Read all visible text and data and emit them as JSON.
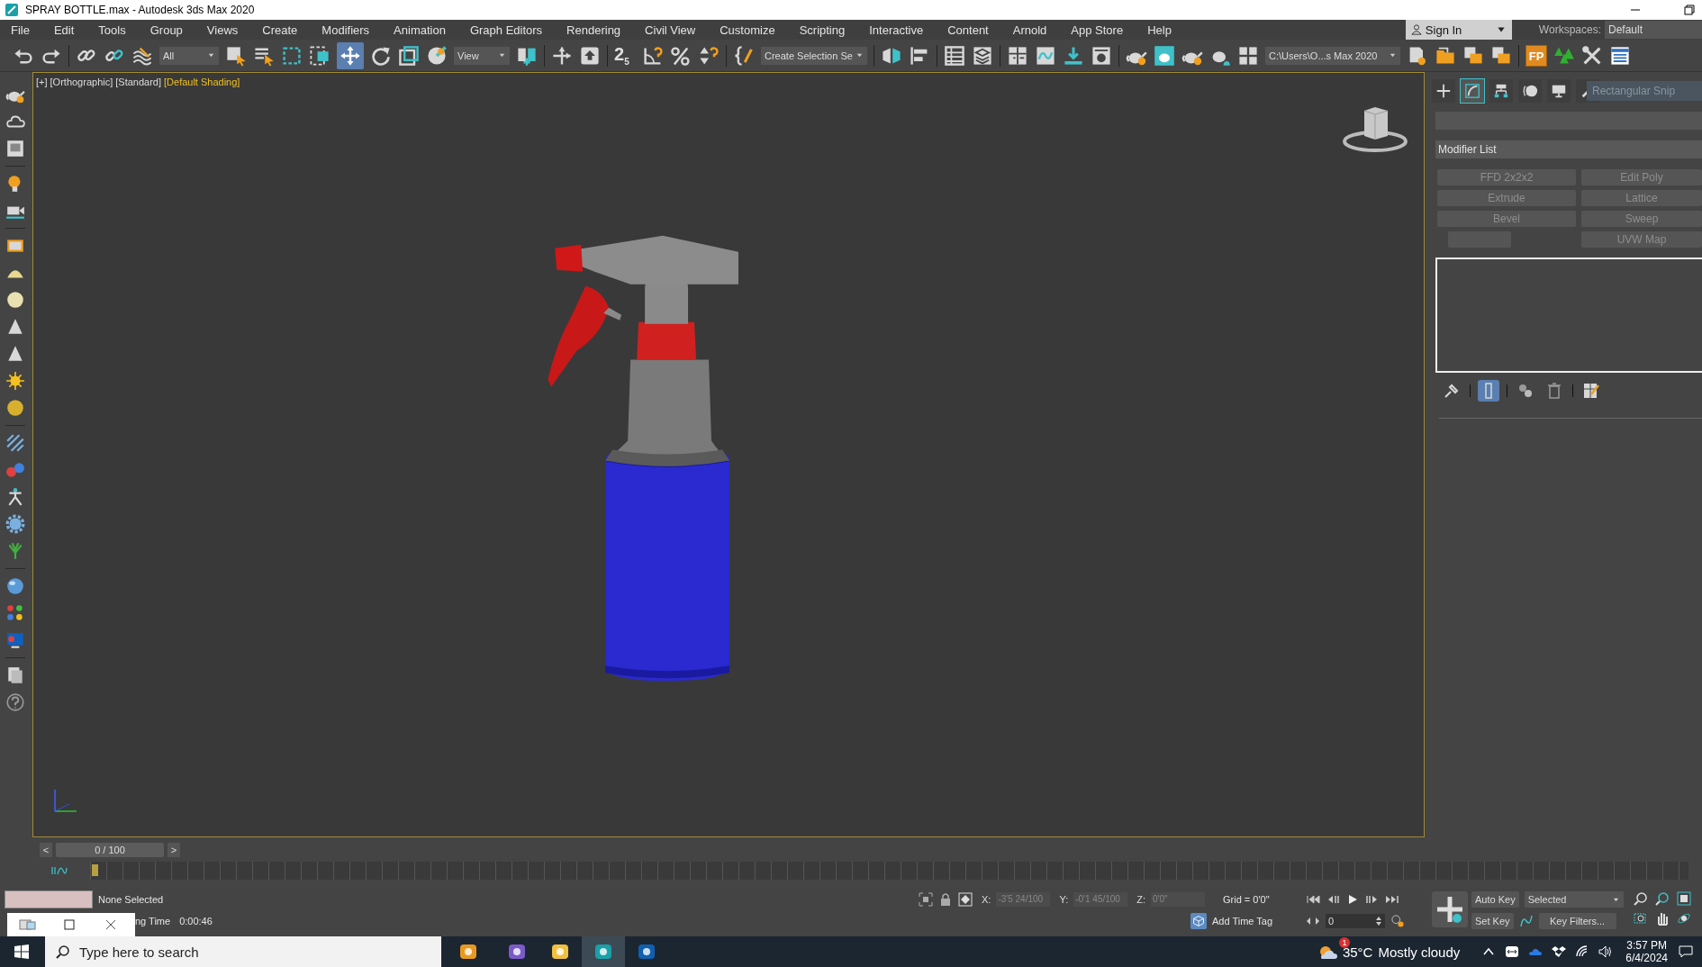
{
  "window": {
    "title": "SPRAY BOTTLE.max - Autodesk 3ds Max 2020"
  },
  "menu": [
    "File",
    "Edit",
    "Tools",
    "Group",
    "Views",
    "Create",
    "Modifiers",
    "Animation",
    "Graph Editors",
    "Rendering",
    "Civil View",
    "Customize",
    "Scripting",
    "Interactive",
    "Content",
    "Arnold",
    "App Store",
    "Help"
  ],
  "account": {
    "sign_in": "Sign In",
    "workspaces_label": "Workspaces:",
    "workspace": "Default"
  },
  "toolbar": {
    "selection_filter": "All",
    "reference_coordinates": "View",
    "snaps_toggle": "2$_{5}$",
    "named_selection": "Create Selection Se",
    "project_folder": "C:\\Users\\O...s Max 2020",
    "fp_button": "FP"
  },
  "viewport": {
    "labels": [
      {
        "text": "[+]",
        "highlighted": false
      },
      {
        "text": "[Orthographic]",
        "highlighted": false
      },
      {
        "text": "[Standard]",
        "highlighted": false
      },
      {
        "text": "[Default Shading]",
        "highlighted": true
      }
    ]
  },
  "command_panel": {
    "tabs": [
      {
        "kind": "create",
        "selected": false
      },
      {
        "kind": "modify",
        "selected": true
      },
      {
        "kind": "hierarchy",
        "selected": false
      },
      {
        "kind": "motion",
        "selected": false
      },
      {
        "kind": "display",
        "selected": false
      },
      {
        "kind": "utilities",
        "selected": false
      }
    ],
    "snip_tooltip": "Rectangular Snip",
    "modifier_list": "Modifier List",
    "modifier_buttons_left": [
      "FFD 2x2x2",
      "Extrude",
      "Bevel"
    ],
    "modifier_buttons_right": [
      "Edit Poly",
      "Lattice",
      "Sweep",
      "UVW Map"
    ],
    "stack_tools": [
      {
        "kind": "pin",
        "selected": false
      },
      {
        "kind": "end-result",
        "selected": true
      },
      {
        "kind": "make-unique",
        "selected": false
      },
      {
        "kind": "remove",
        "selected": false
      },
      {
        "kind": "configure",
        "selected": false
      }
    ]
  },
  "time_slider": {
    "prev": "<",
    "position": "0 / 100",
    "level": 0,
    "next": ">"
  },
  "status": {
    "selection": "None Selected",
    "running_time_label": "ng Time",
    "running_time": "0:00:46",
    "x_label": "X:",
    "x": "-3'5 24/100",
    "y_label": "Y:",
    "y": "-0'1 45/100",
    "z_label": "Z:",
    "z": "0'0\"",
    "grid": "Grid = 0'0\"",
    "add_time_tag": "Add Time Tag",
    "frame": "0",
    "auto_key": "Auto Key",
    "key_mode": "Selected",
    "set_key": "Set Key",
    "key_filters": "Key Filters..."
  },
  "taskbar": {
    "search_placeholder": "Type here to search",
    "apps": [
      {
        "kind": "briefcase",
        "selected": false
      },
      {
        "kind": "torrent",
        "selected": false
      },
      {
        "kind": "folder",
        "selected": false
      },
      {
        "kind": "max",
        "selected": true
      },
      {
        "kind": "sketch",
        "selected": false
      }
    ],
    "weather": {
      "badge": "1",
      "temperature": "35°C",
      "condition": "Mostly cloudy"
    },
    "time": "3:57 PM",
    "date": "6/4/2024"
  }
}
